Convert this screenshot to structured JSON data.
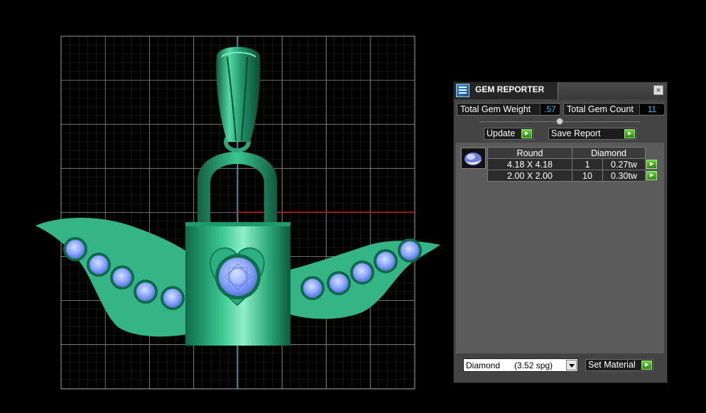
{
  "colors": {
    "viewport_bg": "#000000",
    "grid_line": "#7c7c7c",
    "axis_vertical": "#1ca6c8",
    "axis_horizontal": "#c01212",
    "metal": "#2fb07f",
    "wing": "#34b485",
    "gem": "#8da6ff",
    "accent_value": "#34c4e8",
    "play_green": "#3fae1e"
  },
  "panel": {
    "title": "GEM REPORTER",
    "total_gem_weight_label": "Total Gem Weight",
    "total_gem_weight_value": ".57",
    "total_gem_count_label": "Total Gem Count",
    "total_gem_count_value": "11",
    "update_label": "Update",
    "save_report_label": "Save Report",
    "table": {
      "headers": [
        "Round",
        "Diamond"
      ],
      "rows": [
        {
          "size": "4.18 X 4.18",
          "count": "1",
          "weight": "0.27tw"
        },
        {
          "size": "2.00 X 2.00",
          "count": "10",
          "weight": "0.30tw"
        }
      ]
    },
    "material_select_value": "Diamond      (3.52 spg)",
    "set_material_label": "Set Material"
  },
  "icons": {
    "app": "gem-reporter-app-icon",
    "close": "close-icon",
    "play": "play-arrow-icon",
    "gem_shape": "round-gem-icon",
    "dropdown": "dropdown-arrow-icon"
  }
}
